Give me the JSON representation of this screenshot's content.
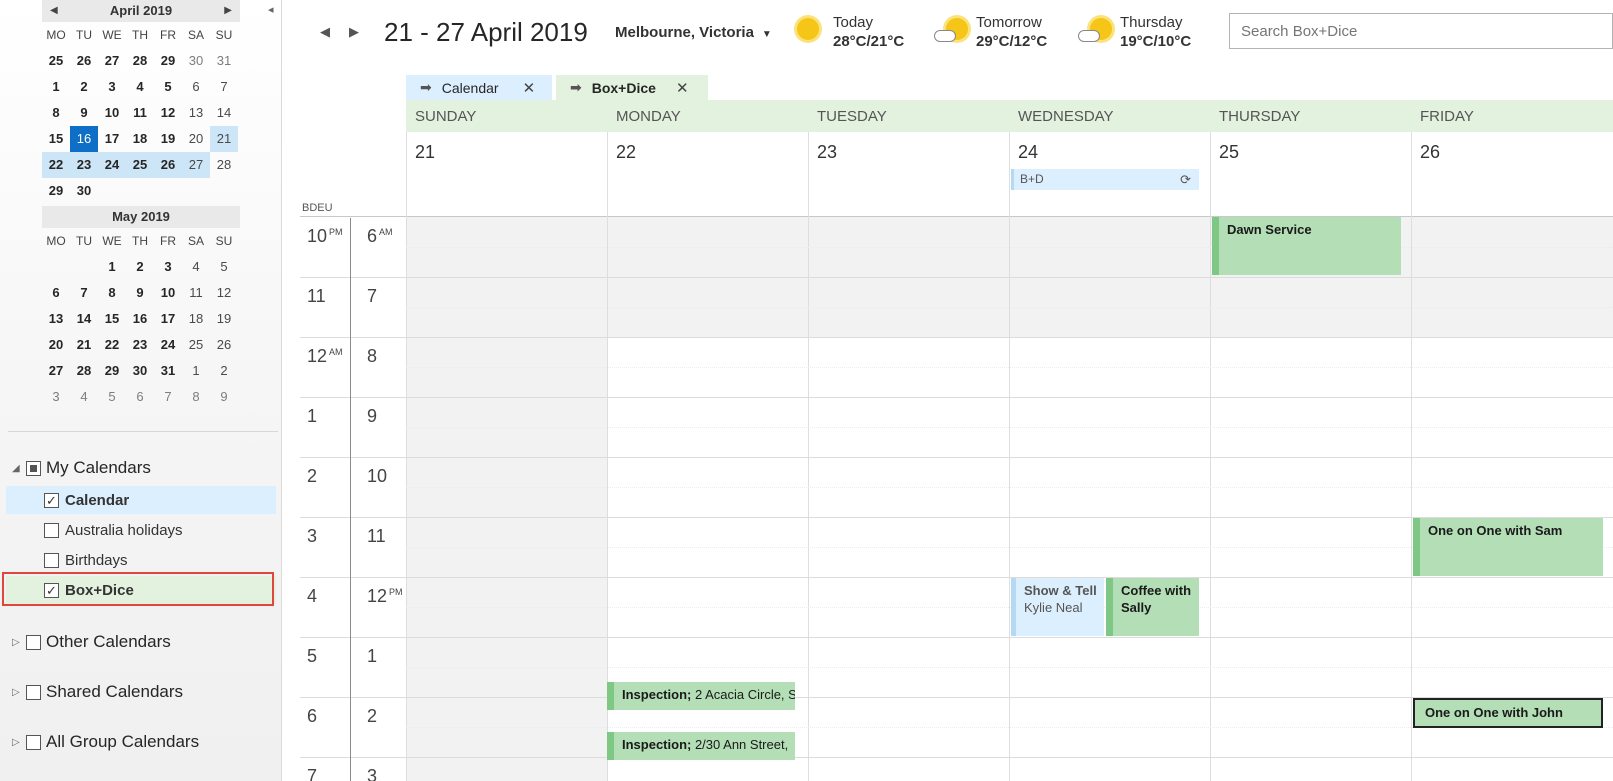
{
  "sidebar": {
    "collapse_icon": "◂",
    "april": {
      "title": "April 2019",
      "dow": [
        "MO",
        "TU",
        "WE",
        "TH",
        "FR",
        "SA",
        "SU"
      ],
      "weeks": [
        [
          "25",
          "26",
          "27",
          "28",
          "29",
          "30",
          "31"
        ],
        [
          "1",
          "2",
          "3",
          "4",
          "5",
          "6",
          "7"
        ],
        [
          "8",
          "9",
          "10",
          "11",
          "12",
          "13",
          "14"
        ],
        [
          "15",
          "16",
          "17",
          "18",
          "19",
          "20",
          "21"
        ],
        [
          "22",
          "23",
          "24",
          "25",
          "26",
          "27",
          "28"
        ],
        [
          "29",
          "30",
          "",
          "",
          "",
          "",
          ""
        ]
      ]
    },
    "may": {
      "title": "May 2019",
      "dow": [
        "MO",
        "TU",
        "WE",
        "TH",
        "FR",
        "SA",
        "SU"
      ],
      "weeks": [
        [
          "",
          "",
          "1",
          "2",
          "3",
          "4",
          "5"
        ],
        [
          "6",
          "7",
          "8",
          "9",
          "10",
          "11",
          "12"
        ],
        [
          "13",
          "14",
          "15",
          "16",
          "17",
          "18",
          "19"
        ],
        [
          "20",
          "21",
          "22",
          "23",
          "24",
          "25",
          "26"
        ],
        [
          "27",
          "28",
          "29",
          "30",
          "31",
          "1",
          "2"
        ],
        [
          "3",
          "4",
          "5",
          "6",
          "7",
          "8",
          "9"
        ]
      ]
    },
    "my_calendars_label": "My Calendars",
    "calendars": [
      {
        "label": "Calendar",
        "checked": true
      },
      {
        "label": "Australia holidays",
        "checked": false
      },
      {
        "label": "Birthdays",
        "checked": false
      },
      {
        "label": "Box+Dice",
        "checked": true
      }
    ],
    "other_calendars_label": "Other Calendars",
    "shared_calendars_label": "Shared Calendars",
    "group_calendars_label": "All Group Calendars"
  },
  "topbar": {
    "week_title": "21 - 27 April 2019",
    "location": "Melbourne, Victoria",
    "weather": [
      {
        "day": "Today",
        "temp": "28°C/21°C",
        "icon": "sun-icon"
      },
      {
        "day": "Tomorrow",
        "temp": "29°C/12°C",
        "icon": "partly-cloudy-icon"
      },
      {
        "day": "Thursday",
        "temp": "19°C/10°C",
        "icon": "partly-cloudy-icon"
      }
    ],
    "search_placeholder": "Search Box+Dice"
  },
  "tabs": [
    {
      "label": "Calendar"
    },
    {
      "label": "Box+Dice"
    }
  ],
  "days": [
    {
      "name": "SUNDAY",
      "date": "21"
    },
    {
      "name": "MONDAY",
      "date": "22"
    },
    {
      "name": "TUESDAY",
      "date": "23"
    },
    {
      "name": "WEDNESDAY",
      "date": "24"
    },
    {
      "name": "THURSDAY",
      "date": "25"
    },
    {
      "name": "FRIDAY",
      "date": "26"
    }
  ],
  "allday_event": {
    "label": "B+D",
    "icon": "sync-icon"
  },
  "timezone_label": "BDEU",
  "hours_left": [
    "10",
    "11",
    "12",
    "1",
    "2",
    "3",
    "4",
    "5",
    "6",
    "7"
  ],
  "hours_left_suffix": {
    "0": "PM",
    "2": "AM"
  },
  "hours_right": [
    "6",
    "7",
    "8",
    "9",
    "10",
    "11",
    "12",
    "1",
    "2",
    "3"
  ],
  "hours_right_suffix": {
    "0": "AM",
    "6": "PM"
  },
  "events": {
    "dawn_service": {
      "title": "Dawn Service"
    },
    "one_on_one_sam": {
      "title": "One on One with Sam"
    },
    "show_and_tell": {
      "title": "Show & Tell",
      "subtitle": "Kylie Neal"
    },
    "coffee_with_sally": {
      "title": "Coffee with Sally"
    },
    "inspection_1": {
      "title": "Inspection;",
      "location": " 2 Acacia Circle, S"
    },
    "inspection_2": {
      "title": "Inspection;",
      "location": " 2/30 Ann Street,"
    },
    "one_on_one_john": {
      "title": "One on One with John"
    }
  },
  "colors": {
    "boxdice_green": "#b3deb6",
    "calendar_blue": "#dcefff",
    "today_blue": "#0f6fc6",
    "highlight_red": "#e0453e"
  }
}
